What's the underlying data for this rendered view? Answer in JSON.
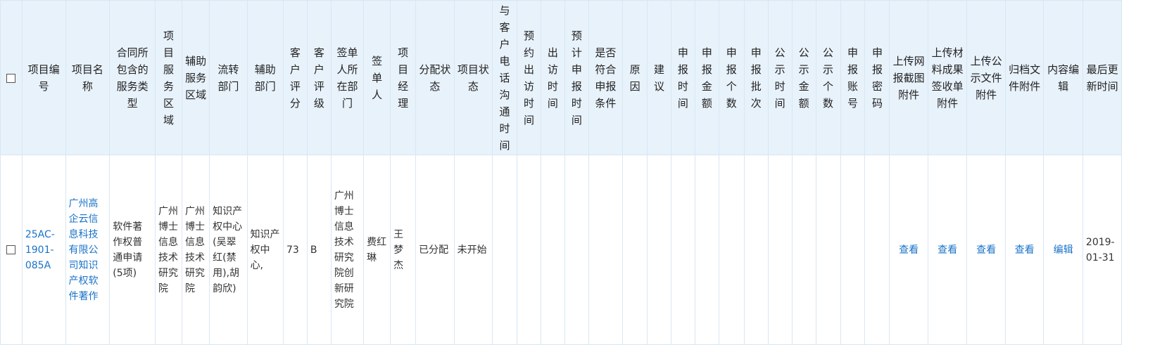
{
  "headers": [
    "项目编号",
    "项目名称",
    "合同所包含的服务类型",
    "项目服务区域",
    "辅助服务区域",
    "流转部门",
    "辅助部门",
    "客户评分",
    "客户评级",
    "签单人所在部门",
    "签单人",
    "项目经理",
    "分配状态",
    "项目状态",
    "与客户电话沟通时间",
    "预约出访时间",
    "出访时间",
    "预计申报时间",
    "是否符合申报条件",
    "原因",
    "建议",
    "申报时间",
    "申报金额",
    "申报个数",
    "申报批次",
    "公示时间",
    "公示金额",
    "公示个数",
    "申报账号",
    "申报密码",
    "上传网报截图附件",
    "上传材料成果签收单附件",
    "上传公示文件附件",
    "归档文件附件",
    "内容编辑",
    "最后更新时间"
  ],
  "row": {
    "project_no": "25AC-1901-085A",
    "project_name": "广州高企云信息科技有限公司知识产权软件著作",
    "service_type": "软件著作权普通申请(5项)",
    "service_area": "广州博士信息技术研究院",
    "aux_area": "广州博士信息技术研究院",
    "transfer_dept": "知识产权中心(吴翠红(禁用),胡韵欣)",
    "aux_dept": "知识产权中心,",
    "customer_score": "73",
    "customer_grade": "B",
    "signer_dept": "广州博士信息技术研究院创新研究院",
    "signer": "费红琳",
    "project_manager": "王梦杰",
    "assign_status": "已分配",
    "project_status": "未开始",
    "view1": "查看",
    "view2": "查看",
    "view3": "查看",
    "view4": "查看",
    "edit": "编辑",
    "updated": "2019-01-31"
  }
}
